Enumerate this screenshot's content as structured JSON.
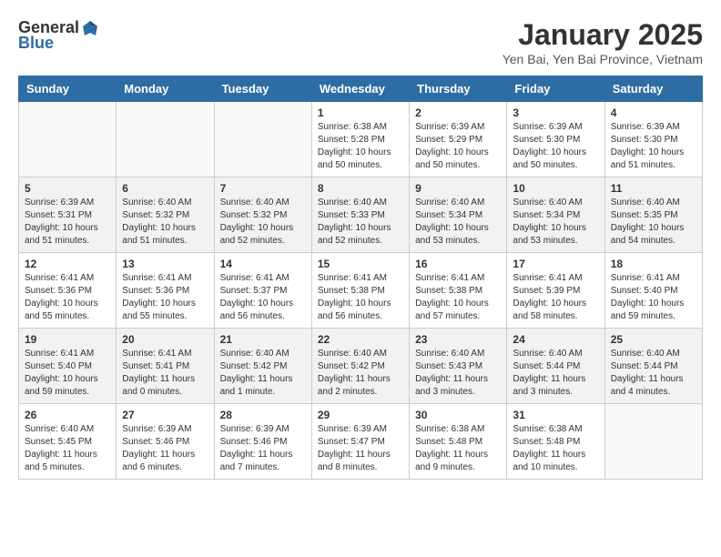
{
  "header": {
    "logo_general": "General",
    "logo_blue": "Blue",
    "title": "January 2025",
    "subtitle": "Yen Bai, Yen Bai Province, Vietnam"
  },
  "weekdays": [
    "Sunday",
    "Monday",
    "Tuesday",
    "Wednesday",
    "Thursday",
    "Friday",
    "Saturday"
  ],
  "weeks": [
    [
      {
        "day": "",
        "info": ""
      },
      {
        "day": "",
        "info": ""
      },
      {
        "day": "",
        "info": ""
      },
      {
        "day": "1",
        "info": "Sunrise: 6:38 AM\nSunset: 5:28 PM\nDaylight: 10 hours\nand 50 minutes."
      },
      {
        "day": "2",
        "info": "Sunrise: 6:39 AM\nSunset: 5:29 PM\nDaylight: 10 hours\nand 50 minutes."
      },
      {
        "day": "3",
        "info": "Sunrise: 6:39 AM\nSunset: 5:30 PM\nDaylight: 10 hours\nand 50 minutes."
      },
      {
        "day": "4",
        "info": "Sunrise: 6:39 AM\nSunset: 5:30 PM\nDaylight: 10 hours\nand 51 minutes."
      }
    ],
    [
      {
        "day": "5",
        "info": "Sunrise: 6:39 AM\nSunset: 5:31 PM\nDaylight: 10 hours\nand 51 minutes."
      },
      {
        "day": "6",
        "info": "Sunrise: 6:40 AM\nSunset: 5:32 PM\nDaylight: 10 hours\nand 51 minutes."
      },
      {
        "day": "7",
        "info": "Sunrise: 6:40 AM\nSunset: 5:32 PM\nDaylight: 10 hours\nand 52 minutes."
      },
      {
        "day": "8",
        "info": "Sunrise: 6:40 AM\nSunset: 5:33 PM\nDaylight: 10 hours\nand 52 minutes."
      },
      {
        "day": "9",
        "info": "Sunrise: 6:40 AM\nSunset: 5:34 PM\nDaylight: 10 hours\nand 53 minutes."
      },
      {
        "day": "10",
        "info": "Sunrise: 6:40 AM\nSunset: 5:34 PM\nDaylight: 10 hours\nand 53 minutes."
      },
      {
        "day": "11",
        "info": "Sunrise: 6:40 AM\nSunset: 5:35 PM\nDaylight: 10 hours\nand 54 minutes."
      }
    ],
    [
      {
        "day": "12",
        "info": "Sunrise: 6:41 AM\nSunset: 5:36 PM\nDaylight: 10 hours\nand 55 minutes."
      },
      {
        "day": "13",
        "info": "Sunrise: 6:41 AM\nSunset: 5:36 PM\nDaylight: 10 hours\nand 55 minutes."
      },
      {
        "day": "14",
        "info": "Sunrise: 6:41 AM\nSunset: 5:37 PM\nDaylight: 10 hours\nand 56 minutes."
      },
      {
        "day": "15",
        "info": "Sunrise: 6:41 AM\nSunset: 5:38 PM\nDaylight: 10 hours\nand 56 minutes."
      },
      {
        "day": "16",
        "info": "Sunrise: 6:41 AM\nSunset: 5:38 PM\nDaylight: 10 hours\nand 57 minutes."
      },
      {
        "day": "17",
        "info": "Sunrise: 6:41 AM\nSunset: 5:39 PM\nDaylight: 10 hours\nand 58 minutes."
      },
      {
        "day": "18",
        "info": "Sunrise: 6:41 AM\nSunset: 5:40 PM\nDaylight: 10 hours\nand 59 minutes."
      }
    ],
    [
      {
        "day": "19",
        "info": "Sunrise: 6:41 AM\nSunset: 5:40 PM\nDaylight: 10 hours\nand 59 minutes."
      },
      {
        "day": "20",
        "info": "Sunrise: 6:41 AM\nSunset: 5:41 PM\nDaylight: 11 hours\nand 0 minutes."
      },
      {
        "day": "21",
        "info": "Sunrise: 6:40 AM\nSunset: 5:42 PM\nDaylight: 11 hours\nand 1 minute."
      },
      {
        "day": "22",
        "info": "Sunrise: 6:40 AM\nSunset: 5:42 PM\nDaylight: 11 hours\nand 2 minutes."
      },
      {
        "day": "23",
        "info": "Sunrise: 6:40 AM\nSunset: 5:43 PM\nDaylight: 11 hours\nand 3 minutes."
      },
      {
        "day": "24",
        "info": "Sunrise: 6:40 AM\nSunset: 5:44 PM\nDaylight: 11 hours\nand 3 minutes."
      },
      {
        "day": "25",
        "info": "Sunrise: 6:40 AM\nSunset: 5:44 PM\nDaylight: 11 hours\nand 4 minutes."
      }
    ],
    [
      {
        "day": "26",
        "info": "Sunrise: 6:40 AM\nSunset: 5:45 PM\nDaylight: 11 hours\nand 5 minutes."
      },
      {
        "day": "27",
        "info": "Sunrise: 6:39 AM\nSunset: 5:46 PM\nDaylight: 11 hours\nand 6 minutes."
      },
      {
        "day": "28",
        "info": "Sunrise: 6:39 AM\nSunset: 5:46 PM\nDaylight: 11 hours\nand 7 minutes."
      },
      {
        "day": "29",
        "info": "Sunrise: 6:39 AM\nSunset: 5:47 PM\nDaylight: 11 hours\nand 8 minutes."
      },
      {
        "day": "30",
        "info": "Sunrise: 6:38 AM\nSunset: 5:48 PM\nDaylight: 11 hours\nand 9 minutes."
      },
      {
        "day": "31",
        "info": "Sunrise: 6:38 AM\nSunset: 5:48 PM\nDaylight: 11 hours\nand 10 minutes."
      },
      {
        "day": "",
        "info": ""
      }
    ]
  ]
}
